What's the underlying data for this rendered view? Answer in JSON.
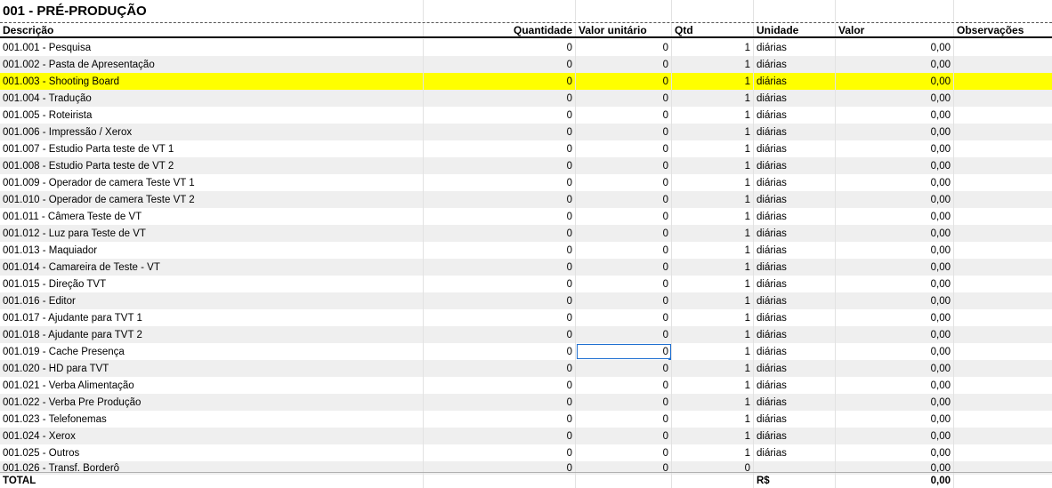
{
  "sheet": {
    "title": "001 - PRÉ-PRODUÇÃO",
    "headers": {
      "descricao": "Descrição",
      "quantidade": "Quantidade",
      "valor_unitario": "Valor unitário",
      "qtd": "Qtd",
      "unidade": "Unidade",
      "valor": "Valor",
      "observacoes": "Observações"
    },
    "rows": [
      {
        "desc": "001.001 - Pesquisa",
        "qtde": "0",
        "vu": "0",
        "qtd": "1",
        "un": "diárias",
        "valor": "0,00"
      },
      {
        "desc": "001.002 - Pasta de Apresentação",
        "qtde": "0",
        "vu": "0",
        "qtd": "1",
        "un": "diárias",
        "valor": "0,00"
      },
      {
        "desc": "001.003 - Shooting Board",
        "qtde": "0",
        "vu": "0",
        "qtd": "1",
        "un": "diárias",
        "valor": "0,00"
      },
      {
        "desc": "001.004 - Tradução",
        "qtde": "0",
        "vu": "0",
        "qtd": "1",
        "un": "diárias",
        "valor": "0,00"
      },
      {
        "desc": "001.005 - Roteirista",
        "qtde": "0",
        "vu": "0",
        "qtd": "1",
        "un": "diárias",
        "valor": "0,00"
      },
      {
        "desc": "001.006 - Impressão / Xerox",
        "qtde": "0",
        "vu": "0",
        "qtd": "1",
        "un": "diárias",
        "valor": "0,00"
      },
      {
        "desc": "001.007 - Estudio Parta teste de VT 1",
        "qtde": "0",
        "vu": "0",
        "qtd": "1",
        "un": "diárias",
        "valor": "0,00"
      },
      {
        "desc": "001.008 - Estudio Parta teste de VT 2",
        "qtde": "0",
        "vu": "0",
        "qtd": "1",
        "un": "diárias",
        "valor": "0,00"
      },
      {
        "desc": "001.009 - Operador de camera Teste VT 1",
        "qtde": "0",
        "vu": "0",
        "qtd": "1",
        "un": "diárias",
        "valor": "0,00"
      },
      {
        "desc": "001.010 - Operador de camera Teste VT 2",
        "qtde": "0",
        "vu": "0",
        "qtd": "1",
        "un": "diárias",
        "valor": "0,00"
      },
      {
        "desc": "001.011 - Câmera Teste de VT",
        "qtde": "0",
        "vu": "0",
        "qtd": "1",
        "un": "diárias",
        "valor": "0,00"
      },
      {
        "desc": "001.012 - Luz para Teste de VT",
        "qtde": "0",
        "vu": "0",
        "qtd": "1",
        "un": "diárias",
        "valor": "0,00"
      },
      {
        "desc": "001.013 - Maquiador",
        "qtde": "0",
        "vu": "0",
        "qtd": "1",
        "un": "diárias",
        "valor": "0,00"
      },
      {
        "desc": "001.014 - Camareira de Teste  - VT",
        "qtde": "0",
        "vu": "0",
        "qtd": "1",
        "un": "diárias",
        "valor": "0,00"
      },
      {
        "desc": "001.015 - Direção TVT",
        "qtde": "0",
        "vu": "0",
        "qtd": "1",
        "un": "diárias",
        "valor": "0,00"
      },
      {
        "desc": "001.016 - Editor",
        "qtde": "0",
        "vu": "0",
        "qtd": "1",
        "un": "diárias",
        "valor": "0,00"
      },
      {
        "desc": "001.017 - Ajudante para TVT 1",
        "qtde": "0",
        "vu": "0",
        "qtd": "1",
        "un": "diárias",
        "valor": "0,00"
      },
      {
        "desc": "001.018 - Ajudante para TVT 2",
        "qtde": "0",
        "vu": "0",
        "qtd": "1",
        "un": "diárias",
        "valor": "0,00"
      },
      {
        "desc": "001.019 - Cache Presença",
        "qtde": "0",
        "vu": "0",
        "qtd": "1",
        "un": "diárias",
        "valor": "0,00"
      },
      {
        "desc": "001.020 - HD para TVT",
        "qtde": "0",
        "vu": "0",
        "qtd": "1",
        "un": "diárias",
        "valor": "0,00"
      },
      {
        "desc": "001.021 - Verba Alimentação",
        "qtde": "0",
        "vu": "0",
        "qtd": "1",
        "un": "diárias",
        "valor": "0,00"
      },
      {
        "desc": "001.022 - Verba Pre Produção",
        "qtde": "0",
        "vu": "0",
        "qtd": "1",
        "un": "diárias",
        "valor": "0,00"
      },
      {
        "desc": "001.023 - Telefonemas",
        "qtde": "0",
        "vu": "0",
        "qtd": "1",
        "un": "diárias",
        "valor": "0,00"
      },
      {
        "desc": "001.024 - Xerox",
        "qtde": "0",
        "vu": "0",
        "qtd": "1",
        "un": "diárias",
        "valor": "0,00"
      },
      {
        "desc": "001.025 - Outros",
        "qtde": "0",
        "vu": "0",
        "qtd": "1",
        "un": "diárias",
        "valor": "0,00"
      },
      {
        "desc": "001.026 - Transf. Borderô",
        "qtde": "0",
        "vu": "0",
        "qtd": "0",
        "un": "",
        "valor": "0,00"
      }
    ],
    "highlight_color": "#ffff00",
    "alt_row_color": "#efefef",
    "selection_color": "#1e6fd0",
    "total": {
      "label": "TOTAL",
      "currency": "R$",
      "value": "0,00"
    }
  }
}
